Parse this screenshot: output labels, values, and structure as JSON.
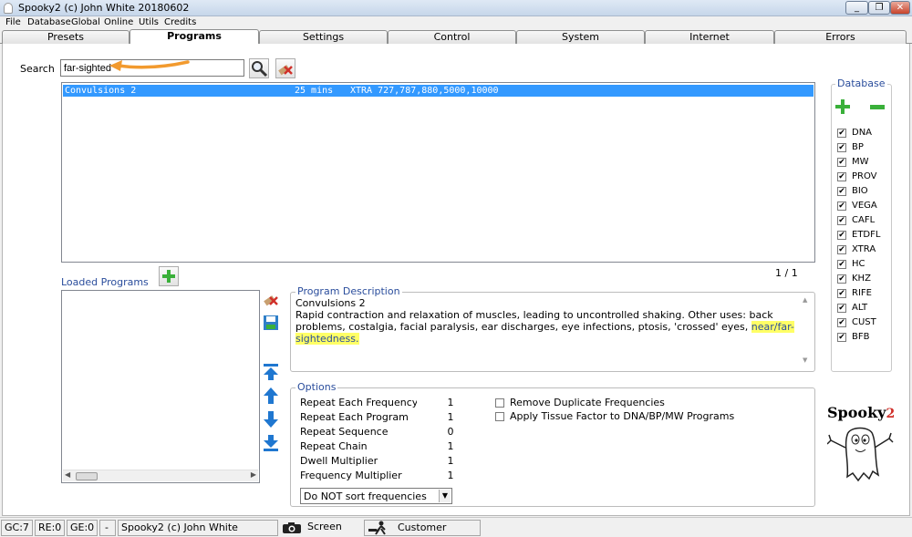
{
  "window": {
    "title": "Spooky2 (c) John White 20180602",
    "controls": [
      "_",
      "❐",
      "✕"
    ]
  },
  "menu": [
    "File",
    "Database",
    "Global",
    "Online",
    "Utils",
    "Credits"
  ],
  "tabs": [
    "Presets",
    "Programs",
    "Settings",
    "Control",
    "System",
    "Internet",
    "Errors"
  ],
  "search": {
    "label": "Search",
    "value": "far-sighted"
  },
  "results": {
    "rows": [
      {
        "name": "Convulsions 2",
        "duration": "25 mins",
        "freqs": "XTRA 727,787,880,5000,10000"
      }
    ],
    "page": "1 / 1"
  },
  "loaded": {
    "label": "Loaded Programs"
  },
  "description": {
    "title": "Program Description",
    "heading": "Convulsions 2",
    "text": "Rapid contraction and relaxation of muscles, leading to uncontrolled shaking. Other uses: back problems, costalgia, facial paralysis, ear discharges, eye infections, ptosis, 'crossed' eyes,",
    "highlight": "near/far-sightedness."
  },
  "options": {
    "title": "Options",
    "rows": [
      {
        "label": "Repeat Each Frequency",
        "value": "1"
      },
      {
        "label": "Repeat Each Program",
        "value": "1"
      },
      {
        "label": "Repeat Sequence",
        "value": "0"
      },
      {
        "label": "Repeat Chain",
        "value": "1"
      },
      {
        "label": "Dwell Multiplier",
        "value": "1"
      },
      {
        "label": "Frequency Multiplier",
        "value": "1"
      }
    ],
    "checks": [
      {
        "label": "Remove Duplicate Frequencies",
        "checked": false
      },
      {
        "label": "Apply Tissue Factor to DNA/BP/MW Programs",
        "checked": false
      }
    ],
    "sort": "Do NOT sort frequencies"
  },
  "database": {
    "title": "Database",
    "items": [
      "DNA",
      "BP",
      "MW",
      "PROV",
      "BIO",
      "VEGA",
      "CAFL",
      "ETDFL",
      "XTRA",
      "HC",
      "KHZ",
      "RIFE",
      "ALT",
      "CUST",
      "BFB"
    ]
  },
  "logo": {
    "text": "Spooky",
    "sup": "2"
  },
  "status": {
    "gc": "GC:7",
    "re": "RE:0",
    "ge": "GE:0",
    "dash": "-",
    "title": "Spooky2 (c) John White 20180602",
    "screenshot": "Screen shot",
    "support": "Customer Support"
  },
  "colors": {
    "accent": "#2a4d9c",
    "selection": "#3399ff",
    "highlight": "#ffff66",
    "arrow": "#f29a2e",
    "add_green": "#3ab03a"
  }
}
